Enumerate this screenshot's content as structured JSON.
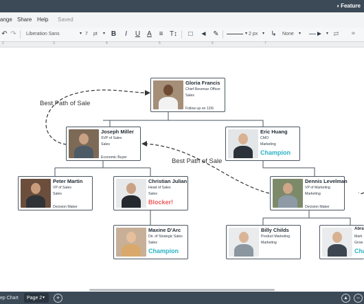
{
  "app": {
    "feature_label": "Feature",
    "menu": [
      "ange",
      "Share",
      "Help"
    ],
    "saved_label": "Saved"
  },
  "toolbar": {
    "font_family": "Liberation Sans",
    "font_size": "7",
    "font_unit": "pt",
    "bold": "B",
    "italic": "I",
    "underline": "U",
    "text_color": "A",
    "line_width": "2 px",
    "arrow_start": "None"
  },
  "ruler": [
    "2",
    "3",
    "4",
    "5",
    "6",
    "7"
  ],
  "annotations": [
    "Best Path of Sale",
    "Best Path of Sale"
  ],
  "cards": [
    {
      "name": "Gloria Francis",
      "title": "Chief Revenue Officer",
      "dept": "Sales",
      "note": "Follow up on 12/6",
      "tag": ""
    },
    {
      "name": "Joseph Miller",
      "title": "SVP of Sales",
      "dept": "Sales",
      "note": "Economic Buyer",
      "tag": ""
    },
    {
      "name": "Eric Huang",
      "title": "CMO",
      "dept": "Marketing",
      "note": "",
      "tag": "Champion"
    },
    {
      "name": "Peter Martin",
      "title": "VP of Sales",
      "dept": "Sales",
      "note": "Decision Maker",
      "tag": ""
    },
    {
      "name": "Christian Julian",
      "title": "Head of Sales",
      "dept": "Sales",
      "note": "",
      "tag": "Blocker!"
    },
    {
      "name": "Dennis Levelman",
      "title": "VP of Marketing",
      "dept": "Marketing",
      "note": "Decision Maker",
      "tag": ""
    },
    {
      "name": "Maxine D'Arc",
      "title": "Dir. of Strategic Sales",
      "dept": "Sales",
      "note": "",
      "tag": "Champion"
    },
    {
      "name": "Billy Childs",
      "title": "Product Marketing",
      "dept": "Marketing",
      "note": "",
      "tag": ""
    },
    {
      "name": "Abra",
      "title": "Mark",
      "dept": "Grow",
      "note": "",
      "tag": "Cha"
    }
  ],
  "bottom": {
    "tab_prev": "ep Chart",
    "tab_current": "Page 2"
  },
  "colors": {
    "chrome_dark": "#3c4a57",
    "champion": "#2ab3c4",
    "blocker": "#ef5b5b",
    "card_border": "#4a5560"
  }
}
